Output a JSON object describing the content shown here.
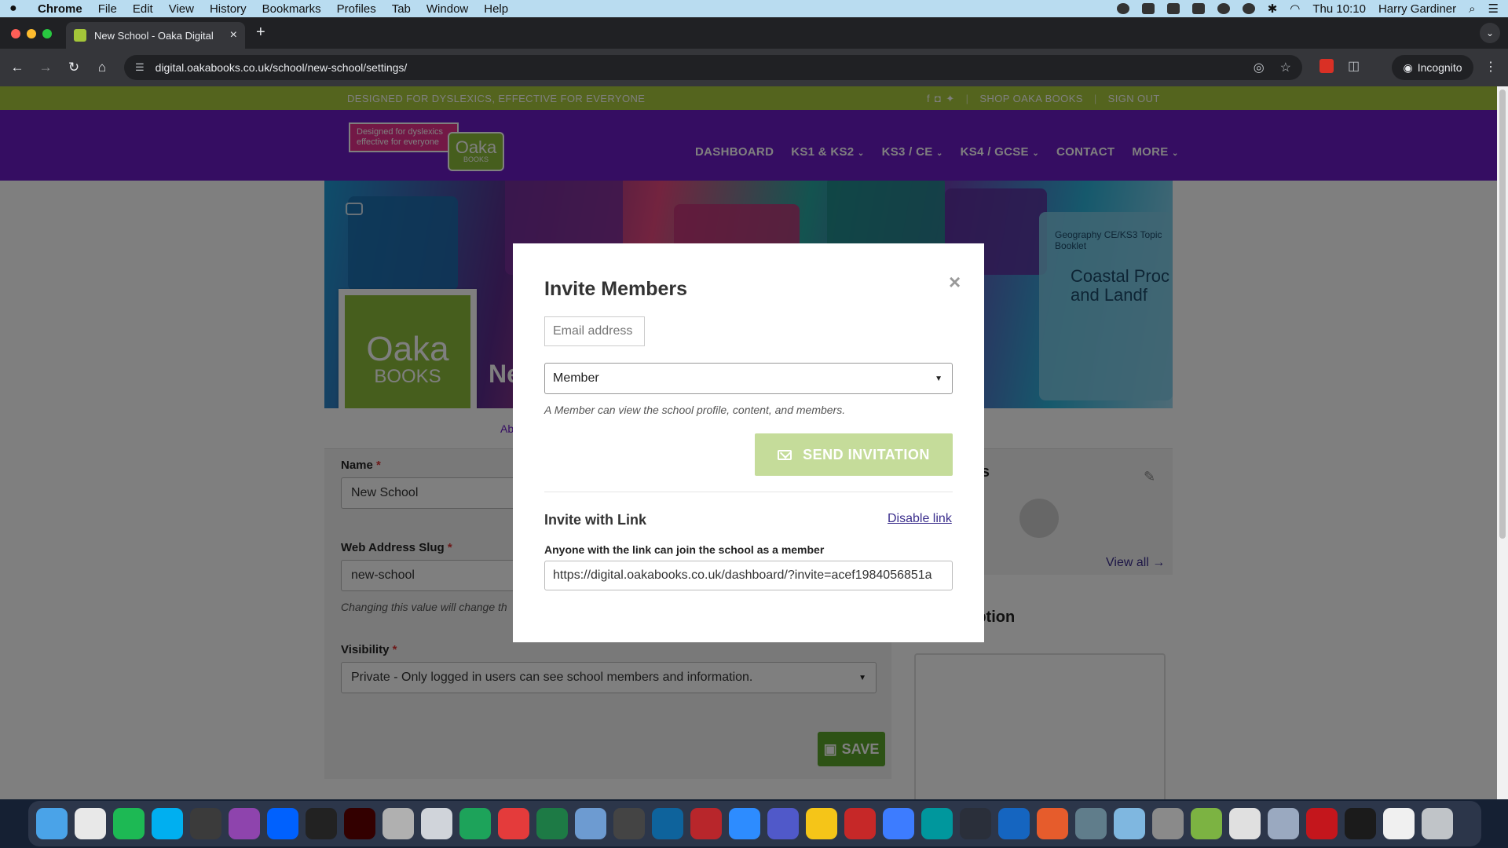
{
  "menubar": {
    "app_name": "Chrome",
    "menus": [
      "File",
      "Edit",
      "View",
      "History",
      "Bookmarks",
      "Profiles",
      "Tab",
      "Window",
      "Help"
    ],
    "clock": "Thu 10:10",
    "user": "Harry Gardiner"
  },
  "browser": {
    "tab_title": "New School - Oaka Digital",
    "url": "digital.oakabooks.co.uk/school/new-school/settings/",
    "profile_label": "Incognito"
  },
  "site": {
    "tagline": "DESIGNED FOR DYSLEXICS, EFFECTIVE FOR EVERYONE",
    "shop_link": "SHOP OAKA BOOKS",
    "signout_link": "SIGN OUT",
    "logo_tag_line1": "Designed for dyslexics",
    "logo_tag_line2": "effective for everyone",
    "logo_name": "Oaka",
    "logo_books": "BOOKS",
    "nav": [
      {
        "label": "DASHBOARD",
        "dropdown": false
      },
      {
        "label": "KS1 & KS2",
        "dropdown": true
      },
      {
        "label": "KS3 / CE",
        "dropdown": true
      },
      {
        "label": "KS4 / GCSE",
        "dropdown": true
      },
      {
        "label": "CONTACT",
        "dropdown": false
      },
      {
        "label": "MORE",
        "dropdown": true
      }
    ]
  },
  "banner": {
    "booklet_text": "Geography CE/KS3 Topic Booklet",
    "coastal_text": "Coastal Proc and Landf"
  },
  "school": {
    "name_partial": "Ne",
    "tab_partial": "Ab",
    "avatar_name": "Oaka",
    "avatar_books": "BOOKS"
  },
  "form": {
    "name_label": "Name",
    "name_value": "New School",
    "slug_label": "Web Address Slug",
    "slug_value": "new-school",
    "slug_help": "Changing this value will change th",
    "visibility_label": "Visibility",
    "visibility_value": "Private - Only logged in users can see school members and information.",
    "required_mark": "*",
    "save_label": "SAVE"
  },
  "sidebar": {
    "members_title_partial": "ers",
    "view_all": "View all →",
    "description_title_partial": "ription"
  },
  "modal": {
    "title": "Invite Members",
    "close": "×",
    "email_placeholder": "Email address",
    "role_value": "Member",
    "role_help": "A Member can view the school profile, content, and members.",
    "send_label": "SEND INVITATION",
    "link_section_title": "Invite with Link",
    "disable_link": "Disable link",
    "link_label": "Anyone with the link can join the school as a member",
    "link_value": "https://digital.oakabooks.co.uk/dashboard/?invite=acef1984056851a"
  },
  "colors": {
    "brand_green": "#a8c83c",
    "brand_purple": "#6a1bc4",
    "button_green_disabled": "#c5dc9a",
    "save_green": "#5aa52a",
    "link_purple": "#3a2d8c"
  },
  "dock_apps": [
    "finder-icon",
    "chrome-icon",
    "spotify-icon",
    "skype-icon",
    "lotus-icon",
    "podcast-icon",
    "dropbox-icon",
    "sonos-icon",
    "illustrator-icon",
    "calculator-icon",
    "mail-icon",
    "green-app-icon",
    "pen-app-icon",
    "excel-icon",
    "network-icon",
    "photobooth-icon",
    "vscode-icon",
    "scissors-icon",
    "zoom-icon",
    "teams-icon",
    "duck-icon",
    "database-icon",
    "arc-icon",
    "arduino-icon",
    "chat-icon",
    "headphones-icon",
    "audio-icon",
    "safari-icon",
    "avatar-icon",
    "settings-icon",
    "chart-icon",
    "flight-icon",
    "preview-icon",
    "acrobat-icon",
    "terminal-icon",
    "document-icon",
    "trash-icon"
  ]
}
